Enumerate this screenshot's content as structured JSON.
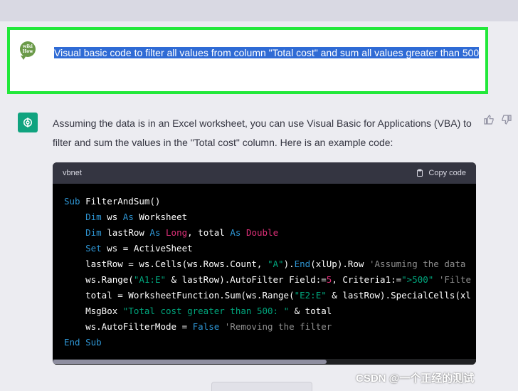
{
  "user_message": {
    "avatar_text": "wiki How",
    "text": "Visual basic code to filter all values from column \"Total cost\" and sum all values greater than 500"
  },
  "assistant_message": {
    "text": "Assuming the data is in an Excel worksheet, you can use Visual Basic for Applications (VBA) to filter and sum the values in the \"Total cost\" column. Here is an example code:"
  },
  "code_block": {
    "language": "vbnet",
    "copy_label": "Copy code"
  },
  "watermark": "CSDN @一个正经的测试",
  "icons": [
    "wikihow-avatar-icon",
    "chatgpt-logo-icon",
    "thumbs-up-icon",
    "thumbs-down-icon",
    "clipboard-icon"
  ],
  "colors": {
    "highlight_border": "#22e83a",
    "selection": "#2f6bd5",
    "gpt_green": "#10a37f"
  }
}
